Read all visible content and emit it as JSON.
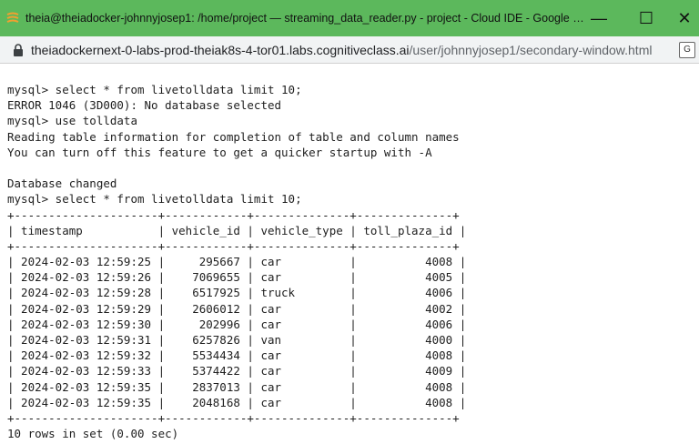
{
  "window": {
    "title": "theia@theiadocker-johnnyjosep1: /home/project — streaming_data_reader.py - project - Cloud IDE - Google Chro...",
    "minimize_label": "—",
    "maximize_label": "☐",
    "close_label": "✕"
  },
  "addressbar": {
    "host": "theiadockernext-0-labs-prod-theiak8s-4-tor01.labs.cognitiveclass.ai",
    "path": "/user/johnnyjosep1/secondary-window.html"
  },
  "terminal": {
    "lines": [
      "mysql> select * from livetolldata limit 10;",
      "ERROR 1046 (3D000): No database selected",
      "mysql> use tolldata",
      "Reading table information for completion of table and column names",
      "You can turn off this feature to get a quicker startup with -A",
      "",
      "Database changed",
      "mysql> select * from livetolldata limit 10;",
      "+---------------------+------------+--------------+--------------+",
      "| timestamp           | vehicle_id | vehicle_type | toll_plaza_id |",
      "+---------------------+------------+--------------+--------------+",
      "| 2024-02-03 12:59:25 |     295667 | car          |          4008 |",
      "| 2024-02-03 12:59:26 |    7069655 | car          |          4005 |",
      "| 2024-02-03 12:59:28 |    6517925 | truck        |          4006 |",
      "| 2024-02-03 12:59:29 |    2606012 | car          |          4002 |",
      "| 2024-02-03 12:59:30 |     202996 | car          |          4006 |",
      "| 2024-02-03 12:59:31 |    6257826 | van          |          4000 |",
      "| 2024-02-03 12:59:32 |    5534434 | car          |          4008 |",
      "| 2024-02-03 12:59:33 |    5374422 | car          |          4009 |",
      "| 2024-02-03 12:59:35 |    2837013 | car          |          4008 |",
      "| 2024-02-03 12:59:35 |    2048168 | car          |          4008 |",
      "+---------------------+------------+--------------+--------------+",
      "10 rows in set (0.00 sec)"
    ]
  }
}
